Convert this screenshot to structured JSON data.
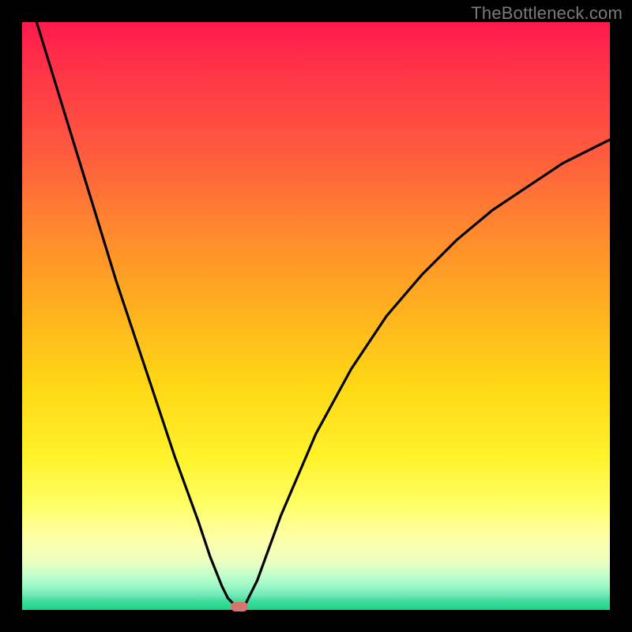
{
  "watermark": "TheBottleneck.com",
  "colors": {
    "frame": "#000000",
    "gradient_top": "#ff1a4d",
    "gradient_bottom": "#1cd487",
    "curve": "#000000",
    "marker": "#d6766f",
    "watermark_text": "#7a7a7a"
  },
  "chart_data": {
    "type": "line",
    "title": "",
    "xlabel": "",
    "ylabel": "",
    "xlim": [
      0,
      100
    ],
    "ylim": [
      0,
      100
    ],
    "series": [
      {
        "name": "bottleneck-curve",
        "x": [
          0,
          4,
          8,
          12,
          16,
          18,
          22,
          26,
          30,
          32,
          34,
          35,
          36,
          37,
          38,
          40,
          44,
          50,
          56,
          62,
          68,
          74,
          80,
          86,
          92,
          98,
          100
        ],
        "values": [
          108,
          95,
          82,
          69,
          56,
          50,
          38,
          26,
          15,
          9,
          4,
          2,
          1,
          0,
          1,
          5,
          16,
          30,
          41,
          50,
          57,
          63,
          68,
          72,
          76,
          79,
          80
        ]
      }
    ],
    "marker": {
      "x": 37,
      "y": 0
    },
    "legend": false,
    "grid": false
  }
}
